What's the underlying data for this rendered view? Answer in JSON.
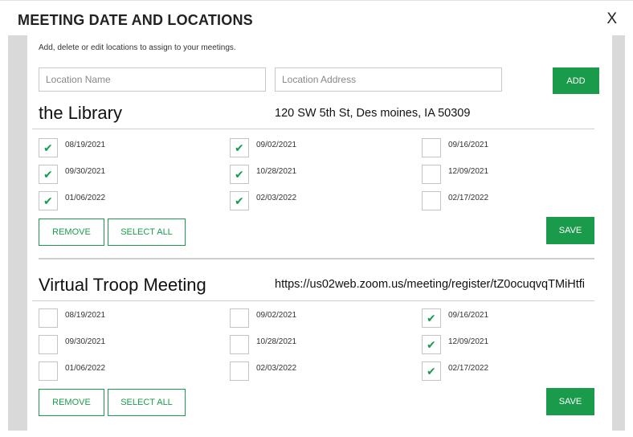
{
  "modal": {
    "title": "MEETING DATE AND LOCATIONS",
    "close_label": "X",
    "instructions": "Add, delete or edit locations to assign to your meetings."
  },
  "form": {
    "name_placeholder": "Location Name",
    "address_placeholder": "Location Address",
    "add_label": "ADD"
  },
  "locations": [
    {
      "name": "the Library",
      "address": "120 SW 5th St, Des moines, IA 50309",
      "dates": [
        {
          "date": "08/19/2021",
          "checked": true
        },
        {
          "date": "09/02/2021",
          "checked": true
        },
        {
          "date": "09/16/2021",
          "checked": false
        },
        {
          "date": "09/30/2021",
          "checked": true
        },
        {
          "date": "10/28/2021",
          "checked": true
        },
        {
          "date": "12/09/2021",
          "checked": false
        },
        {
          "date": "01/06/2022",
          "checked": true
        },
        {
          "date": "02/03/2022",
          "checked": true
        },
        {
          "date": "02/17/2022",
          "checked": false
        }
      ],
      "remove_label": "REMOVE",
      "select_all_label": "SELECT ALL",
      "save_label": "SAVE"
    },
    {
      "name": "Virtual Troop Meeting",
      "address": "https://us02web.zoom.us/meeting/register/tZ0ocuqvqTMiHtfi",
      "dates": [
        {
          "date": "08/19/2021",
          "checked": false
        },
        {
          "date": "09/02/2021",
          "checked": false
        },
        {
          "date": "09/16/2021",
          "checked": true
        },
        {
          "date": "09/30/2021",
          "checked": false
        },
        {
          "date": "10/28/2021",
          "checked": false
        },
        {
          "date": "12/09/2021",
          "checked": true
        },
        {
          "date": "01/06/2022",
          "checked": false
        },
        {
          "date": "02/03/2022",
          "checked": false
        },
        {
          "date": "02/17/2022",
          "checked": true
        }
      ],
      "remove_label": "REMOVE",
      "select_all_label": "SELECT ALL",
      "save_label": "SAVE"
    }
  ],
  "colors": {
    "accent": "#1a9b4c",
    "check": "#1a9b4c"
  },
  "icons": {
    "check": "checkmark-icon"
  }
}
